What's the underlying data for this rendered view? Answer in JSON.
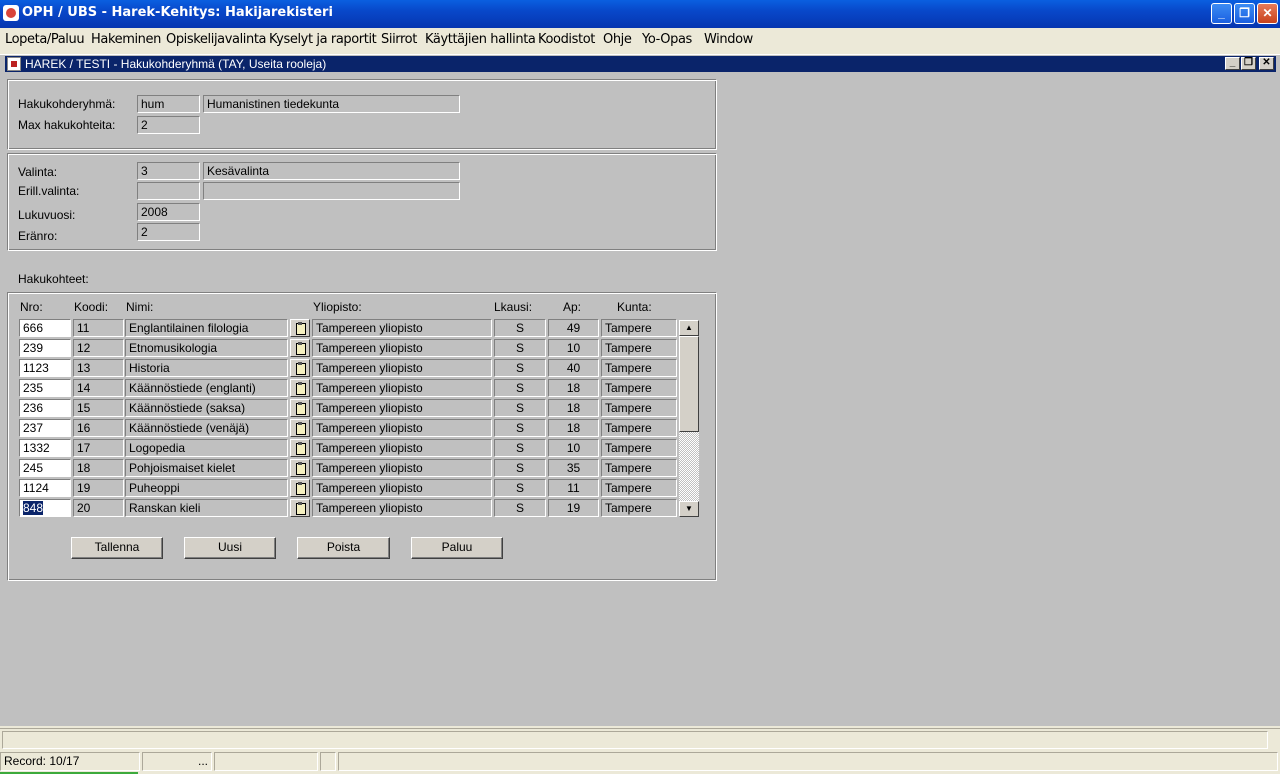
{
  "app": {
    "title": "OPH / UBS - Harek-Kehitys: Hakijarekisteri"
  },
  "menu": [
    "Lopeta/Paluu",
    "Hakeminen",
    "Opiskelijavalinta",
    "Kyselyt ja raportit",
    "Siirrot",
    "Käyttäjien hallinta",
    "Koodistot",
    "Ohje",
    "Yo-Opas",
    "Window"
  ],
  "form": {
    "title": "HAREK / TESTI - Hakukohderyhmä  (TAY, Useita rooleja)",
    "hakukohderyhma_label": "Hakukohderyhmä:",
    "hakukohderyhma_code": "hum",
    "hakukohderyhma_name": "Humanistinen tiedekunta",
    "max_label": "Max hakukohteita:",
    "max_value": "2",
    "valinta_label": "Valinta:",
    "valinta_code": "3",
    "valinta_name": "Kesävalinta",
    "erill_label": "Erill.valinta:",
    "erill_code": "",
    "erill_name": "",
    "lukuvuosi_label": "Lukuvuosi:",
    "lukuvuosi_value": "2008",
    "eranro_label": "Eränro:",
    "eranro_value": "2",
    "hakukohteet_label": "Hakukohteet:"
  },
  "table": {
    "headers": {
      "nro": "Nro:",
      "koodi": "Koodi:",
      "nimi": "Nimi:",
      "yliopisto": "Yliopisto:",
      "lkausi": "Lkausi:",
      "ap": "Ap:",
      "kunta": "Kunta:"
    },
    "rows": [
      {
        "nro": "666",
        "koodi": "11",
        "nimi": "Englantilainen filologia",
        "yliopisto": "Tampereen yliopisto",
        "lkausi": "S",
        "ap": "49",
        "kunta": "Tampere"
      },
      {
        "nro": "239",
        "koodi": "12",
        "nimi": "Etnomusikologia",
        "yliopisto": "Tampereen yliopisto",
        "lkausi": "S",
        "ap": "10",
        "kunta": "Tampere"
      },
      {
        "nro": "1123",
        "koodi": "13",
        "nimi": "Historia",
        "yliopisto": "Tampereen yliopisto",
        "lkausi": "S",
        "ap": "40",
        "kunta": "Tampere"
      },
      {
        "nro": "235",
        "koodi": "14",
        "nimi": "Käännöstiede (englanti)",
        "yliopisto": "Tampereen yliopisto",
        "lkausi": "S",
        "ap": "18",
        "kunta": "Tampere"
      },
      {
        "nro": "236",
        "koodi": "15",
        "nimi": "Käännöstiede (saksa)",
        "yliopisto": "Tampereen yliopisto",
        "lkausi": "S",
        "ap": "18",
        "kunta": "Tampere"
      },
      {
        "nro": "237",
        "koodi": "16",
        "nimi": "Käännöstiede (venäjä)",
        "yliopisto": "Tampereen yliopisto",
        "lkausi": "S",
        "ap": "18",
        "kunta": "Tampere"
      },
      {
        "nro": "1332",
        "koodi": "17",
        "nimi": "Logopedia",
        "yliopisto": "Tampereen yliopisto",
        "lkausi": "S",
        "ap": "10",
        "kunta": "Tampere"
      },
      {
        "nro": "245",
        "koodi": "18",
        "nimi": "Pohjoismaiset kielet",
        "yliopisto": "Tampereen yliopisto",
        "lkausi": "S",
        "ap": "35",
        "kunta": "Tampere"
      },
      {
        "nro": "1124",
        "koodi": "19",
        "nimi": "Puheoppi",
        "yliopisto": "Tampereen yliopisto",
        "lkausi": "S",
        "ap": "11",
        "kunta": "Tampere"
      },
      {
        "nro": "848",
        "koodi": "20",
        "nimi": "Ranskan kieli",
        "yliopisto": "Tampereen yliopisto",
        "lkausi": "S",
        "ap": "19",
        "kunta": "Tampere"
      }
    ]
  },
  "buttons": {
    "save": "Tallenna",
    "new": "Uusi",
    "delete": "Poista",
    "back": "Paluu"
  },
  "status": {
    "record": "Record: 10/17",
    "dots": "..."
  }
}
